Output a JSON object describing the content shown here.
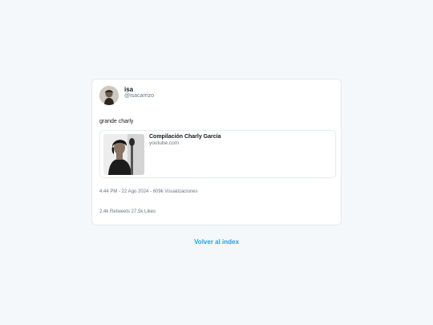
{
  "tweet": {
    "author_name": "isa",
    "author_handle": "@isacarrizo",
    "text": "grande charly",
    "link": {
      "title": "Compilación Charly García",
      "domain": "youtube.com"
    },
    "meta": "4:44 PM - 22 Ago 2024 - 609k Visualizaciones",
    "stats": "2,4k Retweets 27,5k Likes"
  },
  "nav": {
    "back_label": "Volver al index"
  },
  "colors": {
    "background": "#f5f8fa",
    "card": "#ffffff",
    "link": "#1da1f2",
    "muted": "#657786"
  }
}
